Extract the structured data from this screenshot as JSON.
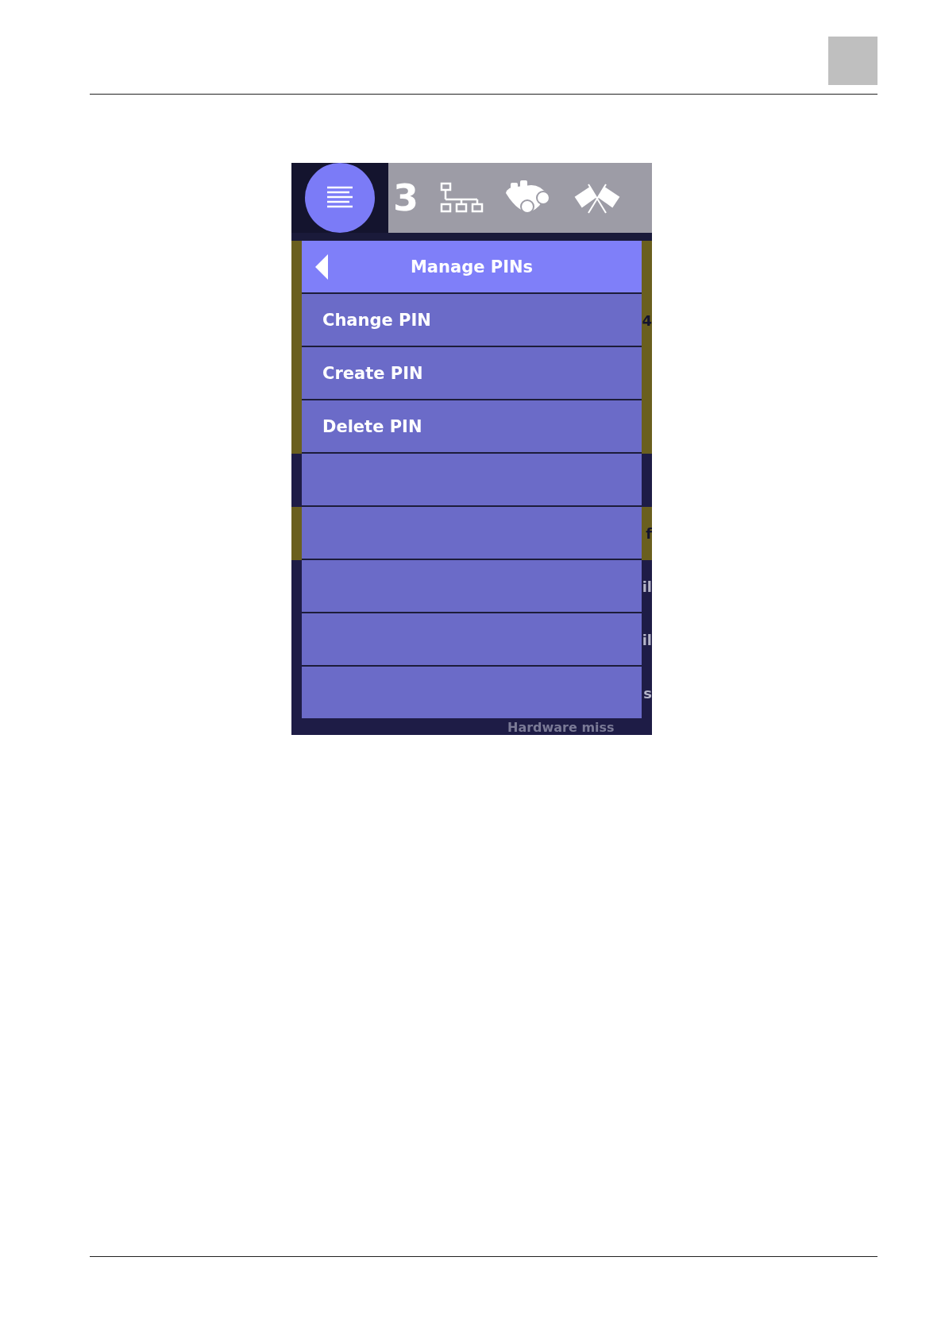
{
  "topbar": {
    "count": "3"
  },
  "menu": {
    "title": "Manage PINs",
    "items": [
      {
        "kind": "option",
        "label": "Change PIN"
      },
      {
        "kind": "option",
        "label": "Create PIN"
      },
      {
        "kind": "option",
        "label": "Delete PIN"
      },
      {
        "kind": "blank"
      },
      {
        "kind": "blank"
      },
      {
        "kind": "blank"
      },
      {
        "kind": "blank"
      },
      {
        "kind": "blank"
      }
    ]
  },
  "background": {
    "rows": [
      {
        "kind": "highlight"
      },
      {
        "kind": "highlight",
        "fragment": "4"
      },
      {
        "kind": "highlight"
      },
      {
        "kind": "highlight"
      },
      {
        "kind": "plain"
      },
      {
        "kind": "highlight",
        "fragment": "f"
      },
      {
        "kind": "plain",
        "fragment": "il"
      },
      {
        "kind": "plain",
        "fragment": "il"
      },
      {
        "kind": "plain",
        "fragment": "s"
      }
    ],
    "footer": "Hardware miss"
  }
}
